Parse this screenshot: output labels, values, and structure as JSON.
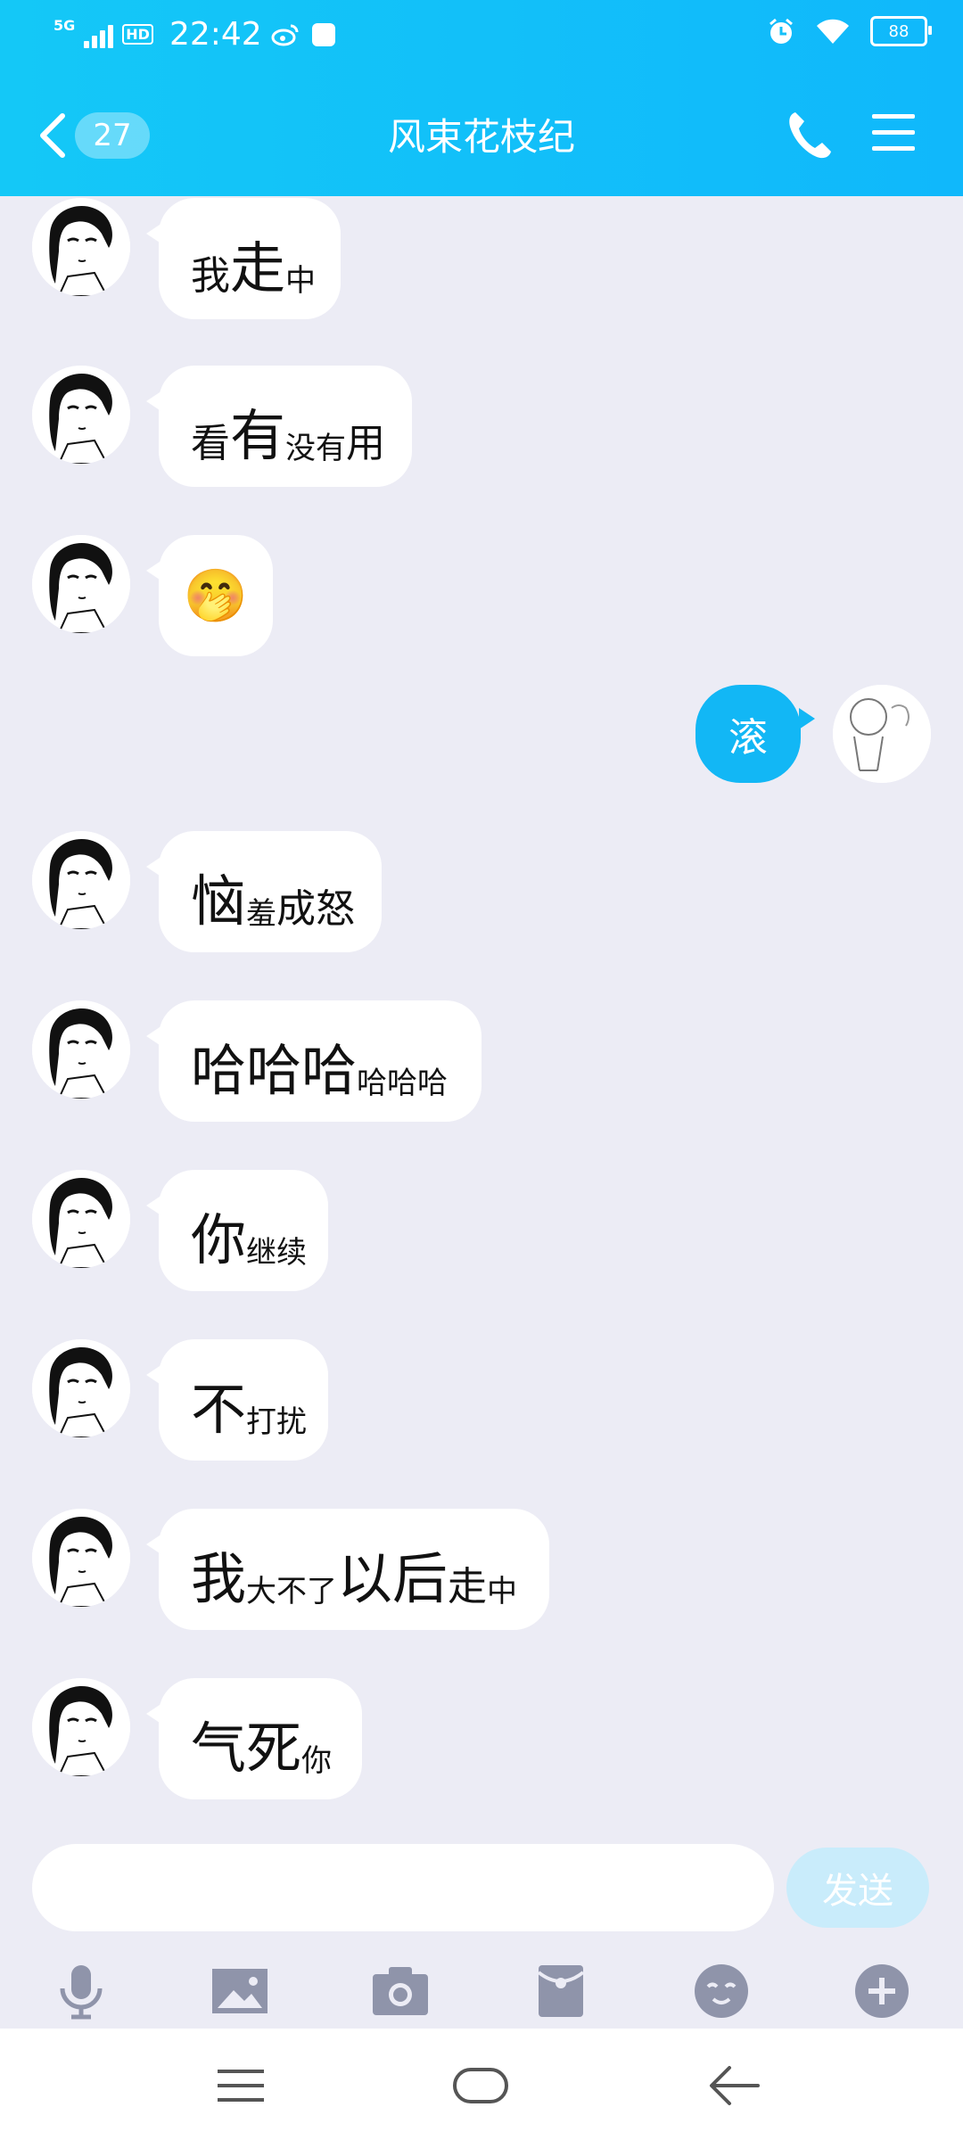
{
  "status_bar": {
    "network": "5G",
    "hd": "HD",
    "time": "22:42",
    "battery": "88"
  },
  "header": {
    "unread_count": "27",
    "title": "风束花枝纪"
  },
  "messages": [
    {
      "direction": "in",
      "parts": [
        [
          "m",
          "我"
        ],
        [
          "l",
          "走"
        ],
        [
          "s",
          "中"
        ]
      ]
    },
    {
      "direction": "in",
      "parts": [
        [
          "m",
          "看"
        ],
        [
          "l",
          "有"
        ],
        [
          "s",
          "没有"
        ],
        [
          "m",
          "用"
        ]
      ]
    },
    {
      "direction": "in",
      "emoji": "🤭"
    },
    {
      "direction": "out",
      "text": "滚"
    },
    {
      "direction": "in",
      "parts": [
        [
          "l",
          "恼"
        ],
        [
          "s",
          "羞"
        ],
        [
          "m",
          "成怒"
        ]
      ]
    },
    {
      "direction": "in",
      "parts": [
        [
          "l",
          "哈哈哈"
        ],
        [
          "s",
          "哈哈哈"
        ]
      ]
    },
    {
      "direction": "in",
      "parts": [
        [
          "l",
          "你"
        ],
        [
          "s",
          "继续"
        ]
      ]
    },
    {
      "direction": "in",
      "parts": [
        [
          "l",
          "不"
        ],
        [
          "s",
          "打扰"
        ]
      ]
    },
    {
      "direction": "in",
      "parts": [
        [
          "l",
          "我"
        ],
        [
          "s",
          "大不了"
        ],
        [
          "l",
          "以后"
        ],
        [
          "m",
          "走"
        ],
        [
          "s",
          "中"
        ]
      ]
    },
    {
      "direction": "in",
      "parts": [
        [
          "l",
          "气死"
        ],
        [
          "s",
          "你"
        ]
      ]
    }
  ],
  "input": {
    "value": "",
    "send_label": "发送"
  },
  "toolbar_icons": [
    "microphone-icon",
    "image-icon",
    "camera-icon",
    "red-packet-icon",
    "emoji-icon",
    "plus-icon"
  ],
  "nav_icons": [
    "menu-icon",
    "home-icon",
    "back-icon"
  ]
}
